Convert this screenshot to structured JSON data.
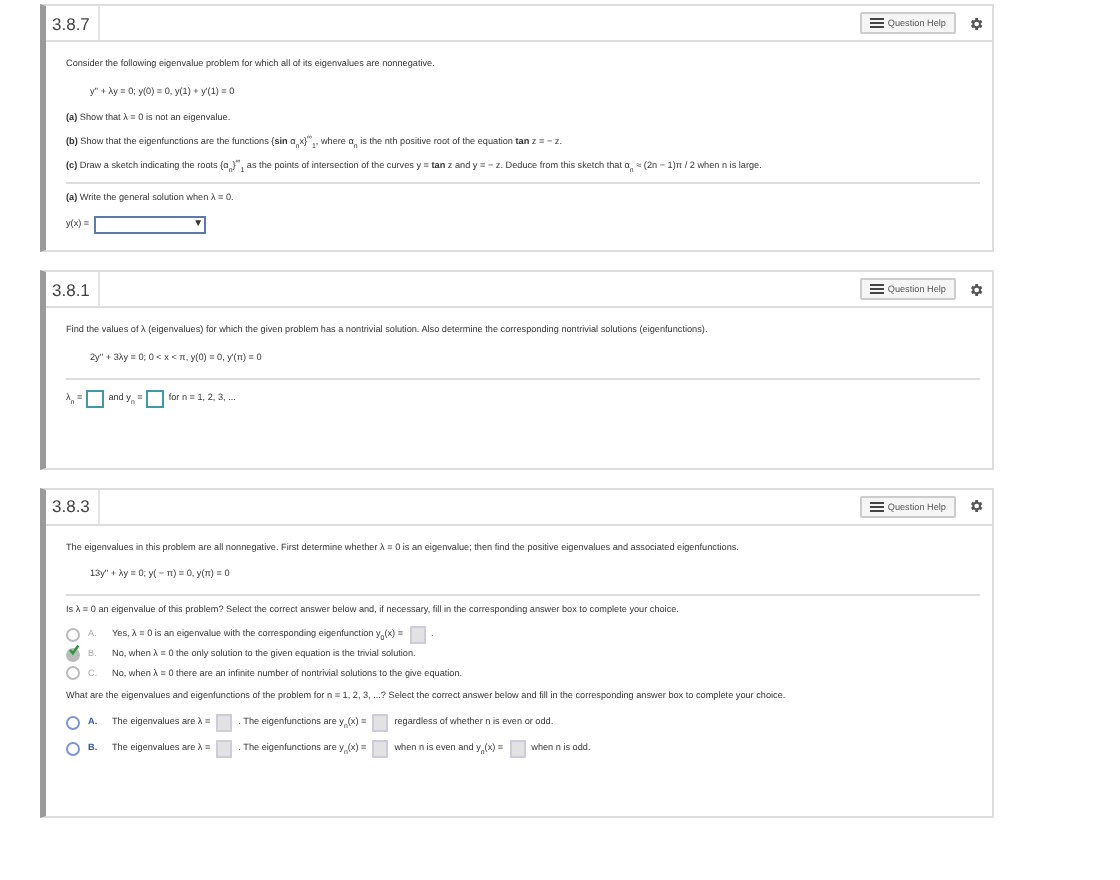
{
  "questions": [
    {
      "number": "3.8.7",
      "help_label": "Question Help",
      "items": [
        {
          "kind": "para",
          "segments": [
            {
              "kind": "text",
              "text": "Consider the following eigenvalue problem for which all of its eigenvalues are nonnegative."
            }
          ]
        },
        {
          "kind": "equation",
          "segments": [
            {
              "kind": "text",
              "text": "y'' + λy = 0; y(0) = 0, y(1) + y'(1) = 0"
            }
          ]
        },
        {
          "kind": "para",
          "segments": [
            {
              "kind": "text",
              "text": "**(a)** Show that λ = 0 is not an eigenvalue."
            }
          ]
        },
        {
          "kind": "tight",
          "segments": [
            {
              "kind": "text",
              "text": "**(b)** Show that the eigenfunctions are the functions {**sin** α$_{n}$x}$^{∞}$$_{1}$, where α$_{n}$ is the nth positive root of the equation **tan** z = − z."
            }
          ]
        },
        {
          "kind": "para",
          "segments": [
            {
              "kind": "text",
              "text": "**(c)** Draw a sketch indicating the roots {α$_{n}$}$^{∞}$$_{1}$ as the points of intersection of the curves y = **tan** z and y = − z. Deduce from this sketch that α$_{n}$ ≈ (2n − 1)π / 2 when n is large."
            }
          ]
        },
        {
          "kind": "divider"
        },
        {
          "kind": "para",
          "segments": [
            {
              "kind": "text",
              "text": "**(a)** Write the general solution when λ = 0."
            }
          ]
        },
        {
          "kind": "answer",
          "segments": [
            {
              "kind": "text",
              "text": "y(x) ="
            },
            {
              "kind": "select",
              "arrow": "▼"
            }
          ]
        }
      ]
    },
    {
      "number": "3.8.1",
      "help_label": "Question Help",
      "items": [
        {
          "kind": "para",
          "segments": [
            {
              "kind": "text",
              "text": "Find the values of λ (eigenvalues) for which the given problem has a nontrivial solution. Also determine the corresponding nontrivial solutions (eigenfunctions)."
            }
          ]
        },
        {
          "kind": "equation",
          "segments": [
            {
              "kind": "text",
              "text": "2y'' + 3λy = 0;   0 < x < π,   y(0) = 0,   y'(π) = 0"
            }
          ]
        },
        {
          "kind": "divider"
        },
        {
          "kind": "answer",
          "segments": [
            {
              "kind": "text",
              "text": "λ$_{n}$ ="
            },
            {
              "kind": "input"
            },
            {
              "kind": "text",
              "text": "and y$_{n}$ ="
            },
            {
              "kind": "input"
            },
            {
              "kind": "text",
              "text": "for n = 1, 2, 3, ..."
            }
          ]
        },
        {
          "kind": "spacer"
        }
      ]
    },
    {
      "number": "3.8.3",
      "help_label": "Question Help",
      "items": [
        {
          "kind": "para",
          "segments": [
            {
              "kind": "text",
              "text": "The eigenvalues in this problem are all nonnegative. First determine whether λ = 0 is an eigenvalue; then find the positive eigenvalues and associated eigenfunctions."
            }
          ]
        },
        {
          "kind": "equation",
          "segments": [
            {
              "kind": "text",
              "text": "13y'' + λy = 0; y( − π) = 0, y(π) = 0"
            }
          ]
        },
        {
          "kind": "divider"
        },
        {
          "kind": "para",
          "segments": [
            {
              "kind": "text",
              "text": "Is λ = 0 an eigenvalue of this problem? Select the correct answer below and, if necessary, fill in the corresponding answer box to complete your choice."
            }
          ]
        },
        {
          "kind": "choice",
          "letter": "A.",
          "selected": false,
          "correct": false,
          "disabled": true,
          "segments": [
            {
              "kind": "text",
              "text": "Yes, λ = 0 is an eigenvalue with the corresponding eigenfunction y$_{0}$(x) ="
            },
            {
              "kind": "blank"
            },
            {
              "kind": "text",
              "text": "."
            }
          ]
        },
        {
          "kind": "choice",
          "letter": "B.",
          "selected": true,
          "correct": true,
          "disabled": true,
          "segments": [
            {
              "kind": "text",
              "text": "No, when λ = 0 the only solution to the given equation is the trivial solution."
            }
          ]
        },
        {
          "kind": "choice",
          "letter": "C.",
          "selected": false,
          "correct": false,
          "disabled": true,
          "segments": [
            {
              "kind": "text",
              "text": "No, when λ = 0 there are an infinite number of nontrivial solutions to the give equation."
            }
          ]
        },
        {
          "kind": "para",
          "segments": [
            {
              "kind": "text",
              "text": "What are the eigenvalues and eigenfunctions of the problem for n = 1, 2, 3, ...? Select the correct answer below and fill in the corresponding answer box to complete your choice."
            }
          ]
        },
        {
          "kind": "choice",
          "letter": "A.",
          "selected": false,
          "correct": false,
          "disabled": false,
          "segments": [
            {
              "kind": "text",
              "text": "The eigenvalues are λ ="
            },
            {
              "kind": "blank"
            },
            {
              "kind": "text",
              "text": ". The eigenfunctions are y$_{n}$(x) ="
            },
            {
              "kind": "blank"
            },
            {
              "kind": "text",
              "text": "regardless of whether n is even or odd."
            }
          ]
        },
        {
          "kind": "choice",
          "letter": "B.",
          "selected": false,
          "correct": false,
          "disabled": false,
          "segments": [
            {
              "kind": "text",
              "text": "The eigenvalues are λ ="
            },
            {
              "kind": "blank"
            },
            {
              "kind": "text",
              "text": ". The eigenfunctions are y$_{n}$(x) ="
            },
            {
              "kind": "blank"
            },
            {
              "kind": "text",
              "text": "when n is even and y$_{n}$(x) ="
            },
            {
              "kind": "blank"
            },
            {
              "kind": "text",
              "text": "when n is odd."
            }
          ]
        },
        {
          "kind": "spacer"
        }
      ]
    }
  ]
}
